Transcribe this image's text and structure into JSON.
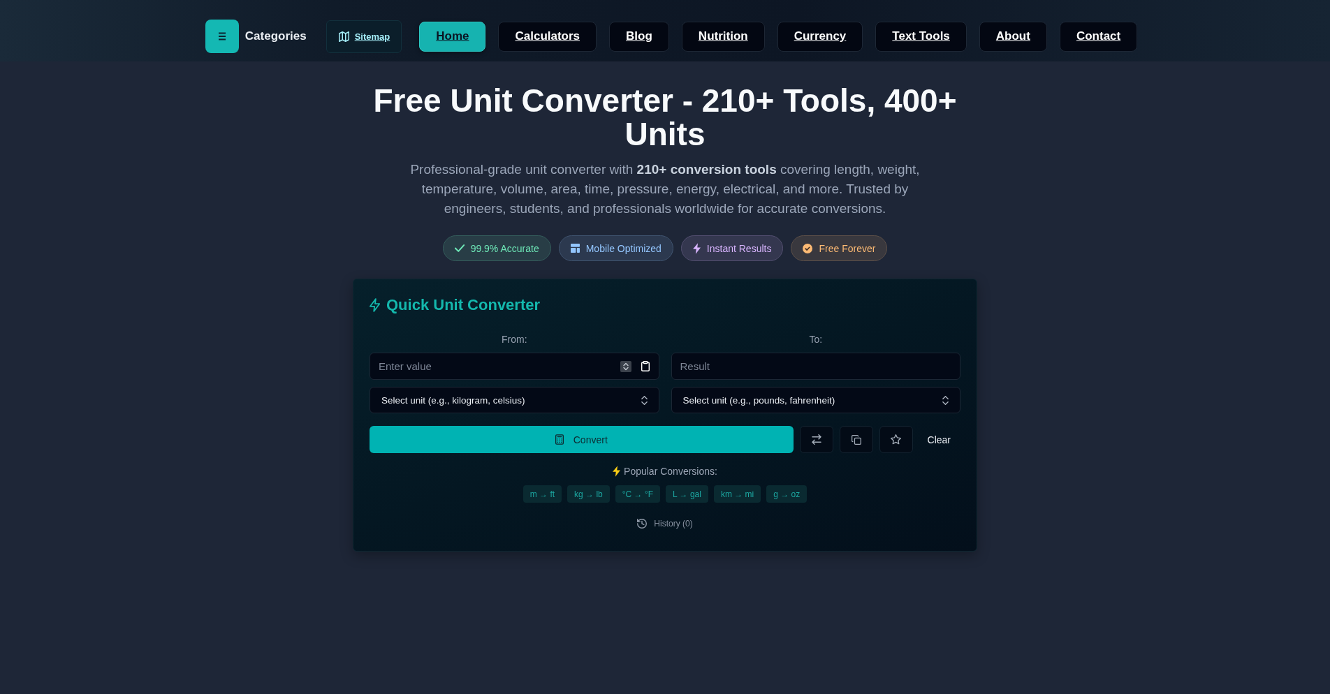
{
  "header": {
    "categories_label": "Categories",
    "nav": [
      {
        "label": "Sitemap",
        "kind": "sitemap",
        "selected": false
      },
      {
        "label": "Home",
        "kind": "page",
        "selected": true
      },
      {
        "label": "Calculators",
        "kind": "page",
        "selected": false
      },
      {
        "label": "Blog",
        "kind": "page",
        "selected": false
      },
      {
        "label": "Nutrition",
        "kind": "page",
        "selected": false
      },
      {
        "label": "Currency",
        "kind": "page",
        "selected": false
      },
      {
        "label": "Text Tools",
        "kind": "page",
        "selected": false
      },
      {
        "label": "About",
        "kind": "page",
        "selected": false
      },
      {
        "label": "Contact",
        "kind": "page",
        "selected": false
      }
    ]
  },
  "hero": {
    "title": "Free Unit Converter - 210+ Tools, 400+ Units",
    "subtitle": "Professional-grade unit converter with **210+ conversion tools** covering length, weight, temperature, volume, area, time, pressure, energy, electrical, and more. Trusted by engineers, students, and professionals worldwide for accurate conversions.",
    "badges": [
      {
        "label": "99.9% Accurate",
        "color": "#6ee7b7"
      },
      {
        "label": "Mobile Optimized",
        "color": "#93c5fd"
      },
      {
        "label": "Instant Results",
        "color": "#d8b4fe"
      },
      {
        "label": "Free Forever",
        "color": "#fdba74"
      }
    ]
  },
  "converter": {
    "title": "Quick Unit Converter",
    "from": {
      "label": "From:",
      "value_field": {
        "placeholder": "Enter value"
      },
      "unit_select": {
        "value": "Select unit (e.g., kilogram, celsius)"
      }
    },
    "to": {
      "label": "To:",
      "result_field": {
        "placeholder": "Result"
      },
      "unit_select": {
        "value": "Select unit (e.g., pounds, fahrenheit)"
      }
    },
    "convert_button": "Convert",
    "clear_button": "Clear",
    "popular_label": "Popular Conversions:",
    "popular_conversions": [
      "m → ft",
      "kg → lb",
      "°C → °F",
      "L → gal",
      "km → mi",
      "g → oz"
    ],
    "history_button": "History (0)"
  }
}
